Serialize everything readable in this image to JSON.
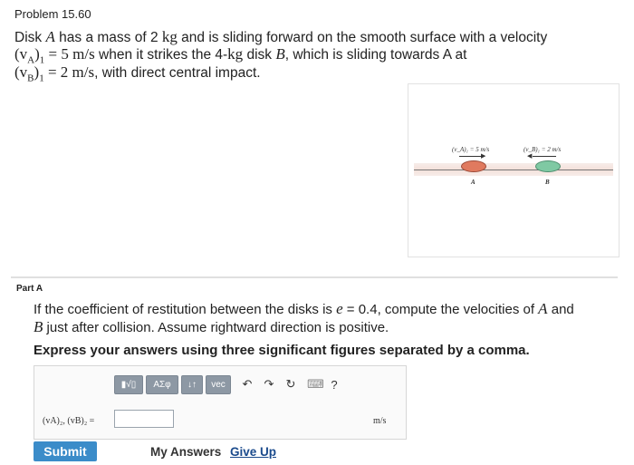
{
  "problem": {
    "title": "Problem 15.60",
    "line1_pre": "Disk ",
    "line1_A": "A",
    "line1_mid": " has a mass of 2 ",
    "line1_kg": "kg",
    "line1_post": " and is sliding forward on the smooth surface with a velocity",
    "line2_v": "(v",
    "line2_sub": "A",
    "line2_close": ")",
    "line2_sub1": "1",
    "line2_eq": " = 5 m/s",
    "line2_post": " when it strikes the 4-",
    "line2_kg": "kg",
    "line2_post2": " disk ",
    "line2_B": "B",
    "line2_post3": ", which is sliding towards A at",
    "line3_v": "(v",
    "line3_sub": "B",
    "line3_close": ")",
    "line3_sub1": "1",
    "line3_eq": " = 2 m/s",
    "line3_post": ", with direct central impact."
  },
  "figure": {
    "vA_label": "(v_A)₁ = 5 m/s",
    "vB_label": "(v_B)₁ = 2 m/s",
    "disk_A_label": "A",
    "disk_B_label": "B",
    "disk_A_color": "#e07a5f",
    "disk_B_color": "#7fc9a3"
  },
  "part": {
    "label": "Part A",
    "q1_pre": "If the coefficient of restitution between the disks is ",
    "q1_e": "e",
    "q1_eq": " = 0.4, compute the velocities of ",
    "q1_A": "A",
    "q1_post": " and",
    "q2_B": "B",
    "q2_post": " just after collision. Assume rightward direction is positive.",
    "instruction": "Express your answers using three significant figures separated by a comma."
  },
  "answer": {
    "toolbar": {
      "matrix_label": "▮√▯",
      "symbols_label": "ΑΣφ",
      "arrows_label": "↓↑",
      "vec_label": "vec",
      "undo_icon": "↶",
      "redo_icon": "↷",
      "reset_icon": "↻",
      "keyboard_icon": "⌨",
      "help_icon": "?"
    },
    "label": "(vA)₂, (vB)₂ =",
    "value": "",
    "unit": "m/s"
  },
  "actions": {
    "submit_label": "Submit",
    "my_answers_label": "My Answers",
    "give_up_label": "Give Up"
  },
  "colors": {
    "submit_bg": "#3b8cc9",
    "link": "#1a4a8c",
    "toolbar_btn": "#8d98a4"
  }
}
